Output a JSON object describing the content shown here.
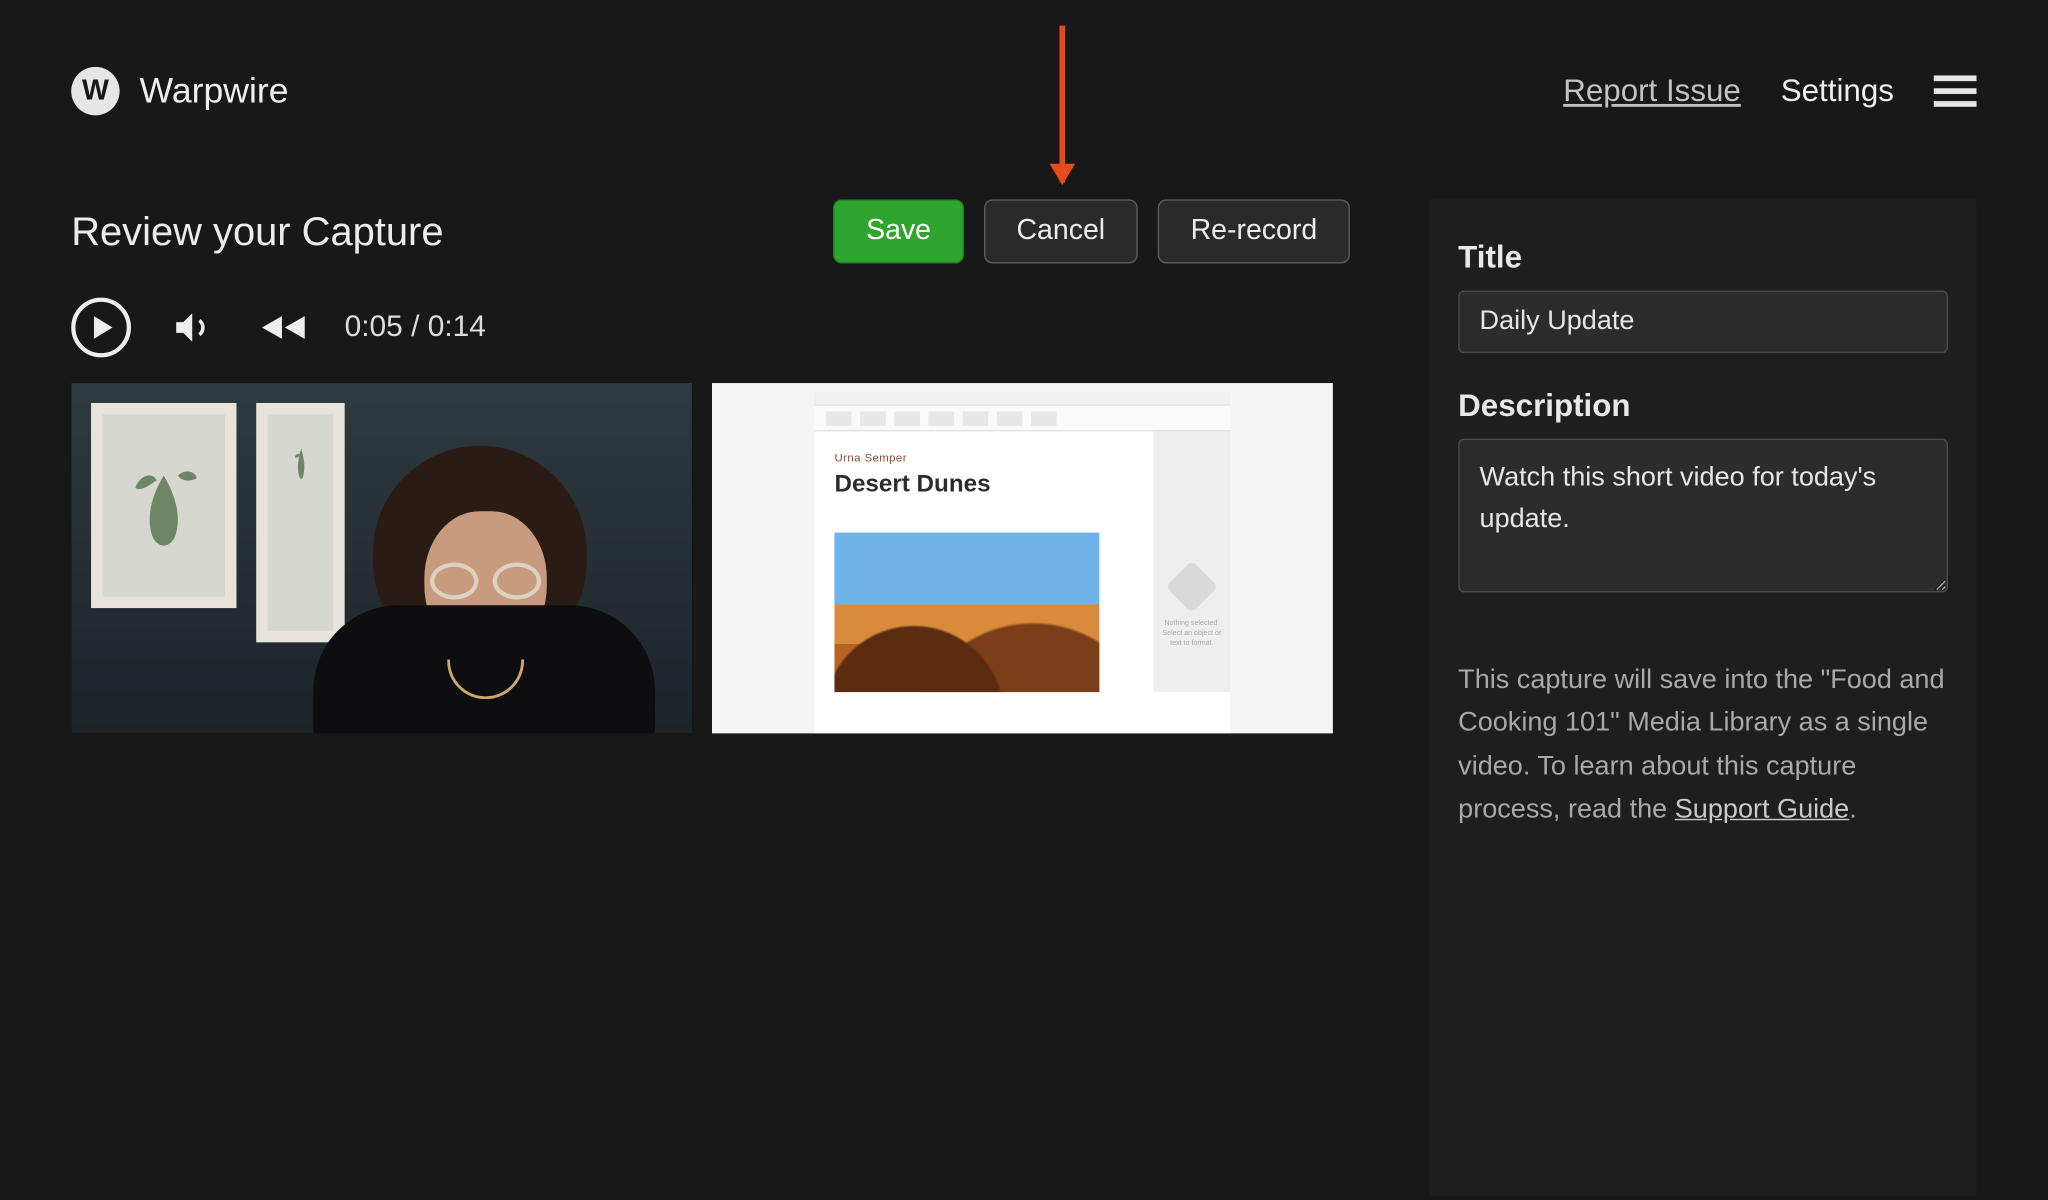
{
  "header": {
    "brand_initial": "W",
    "brand_name": "Warpwire",
    "report_issue": "Report Issue",
    "settings": "Settings"
  },
  "page": {
    "title": "Review your Capture"
  },
  "actions": {
    "save": "Save",
    "cancel": "Cancel",
    "rerecord": "Re-record"
  },
  "player": {
    "timecode": "0:05 / 0:14"
  },
  "screenshare": {
    "subtitle": "Urna Semper",
    "title": "Desert Dunes",
    "side_caption": "Nothing selected. Select an object or text to format."
  },
  "form": {
    "title_label": "Title",
    "title_value": "Daily Update",
    "description_label": "Description",
    "description_value": "Watch this short video for today's update."
  },
  "helper": {
    "text_before": "This capture will save into the \"Food and Cooking 101\" Media Library as a single video. To learn about this capture process, read the ",
    "link": "Support Guide",
    "text_after": "."
  }
}
